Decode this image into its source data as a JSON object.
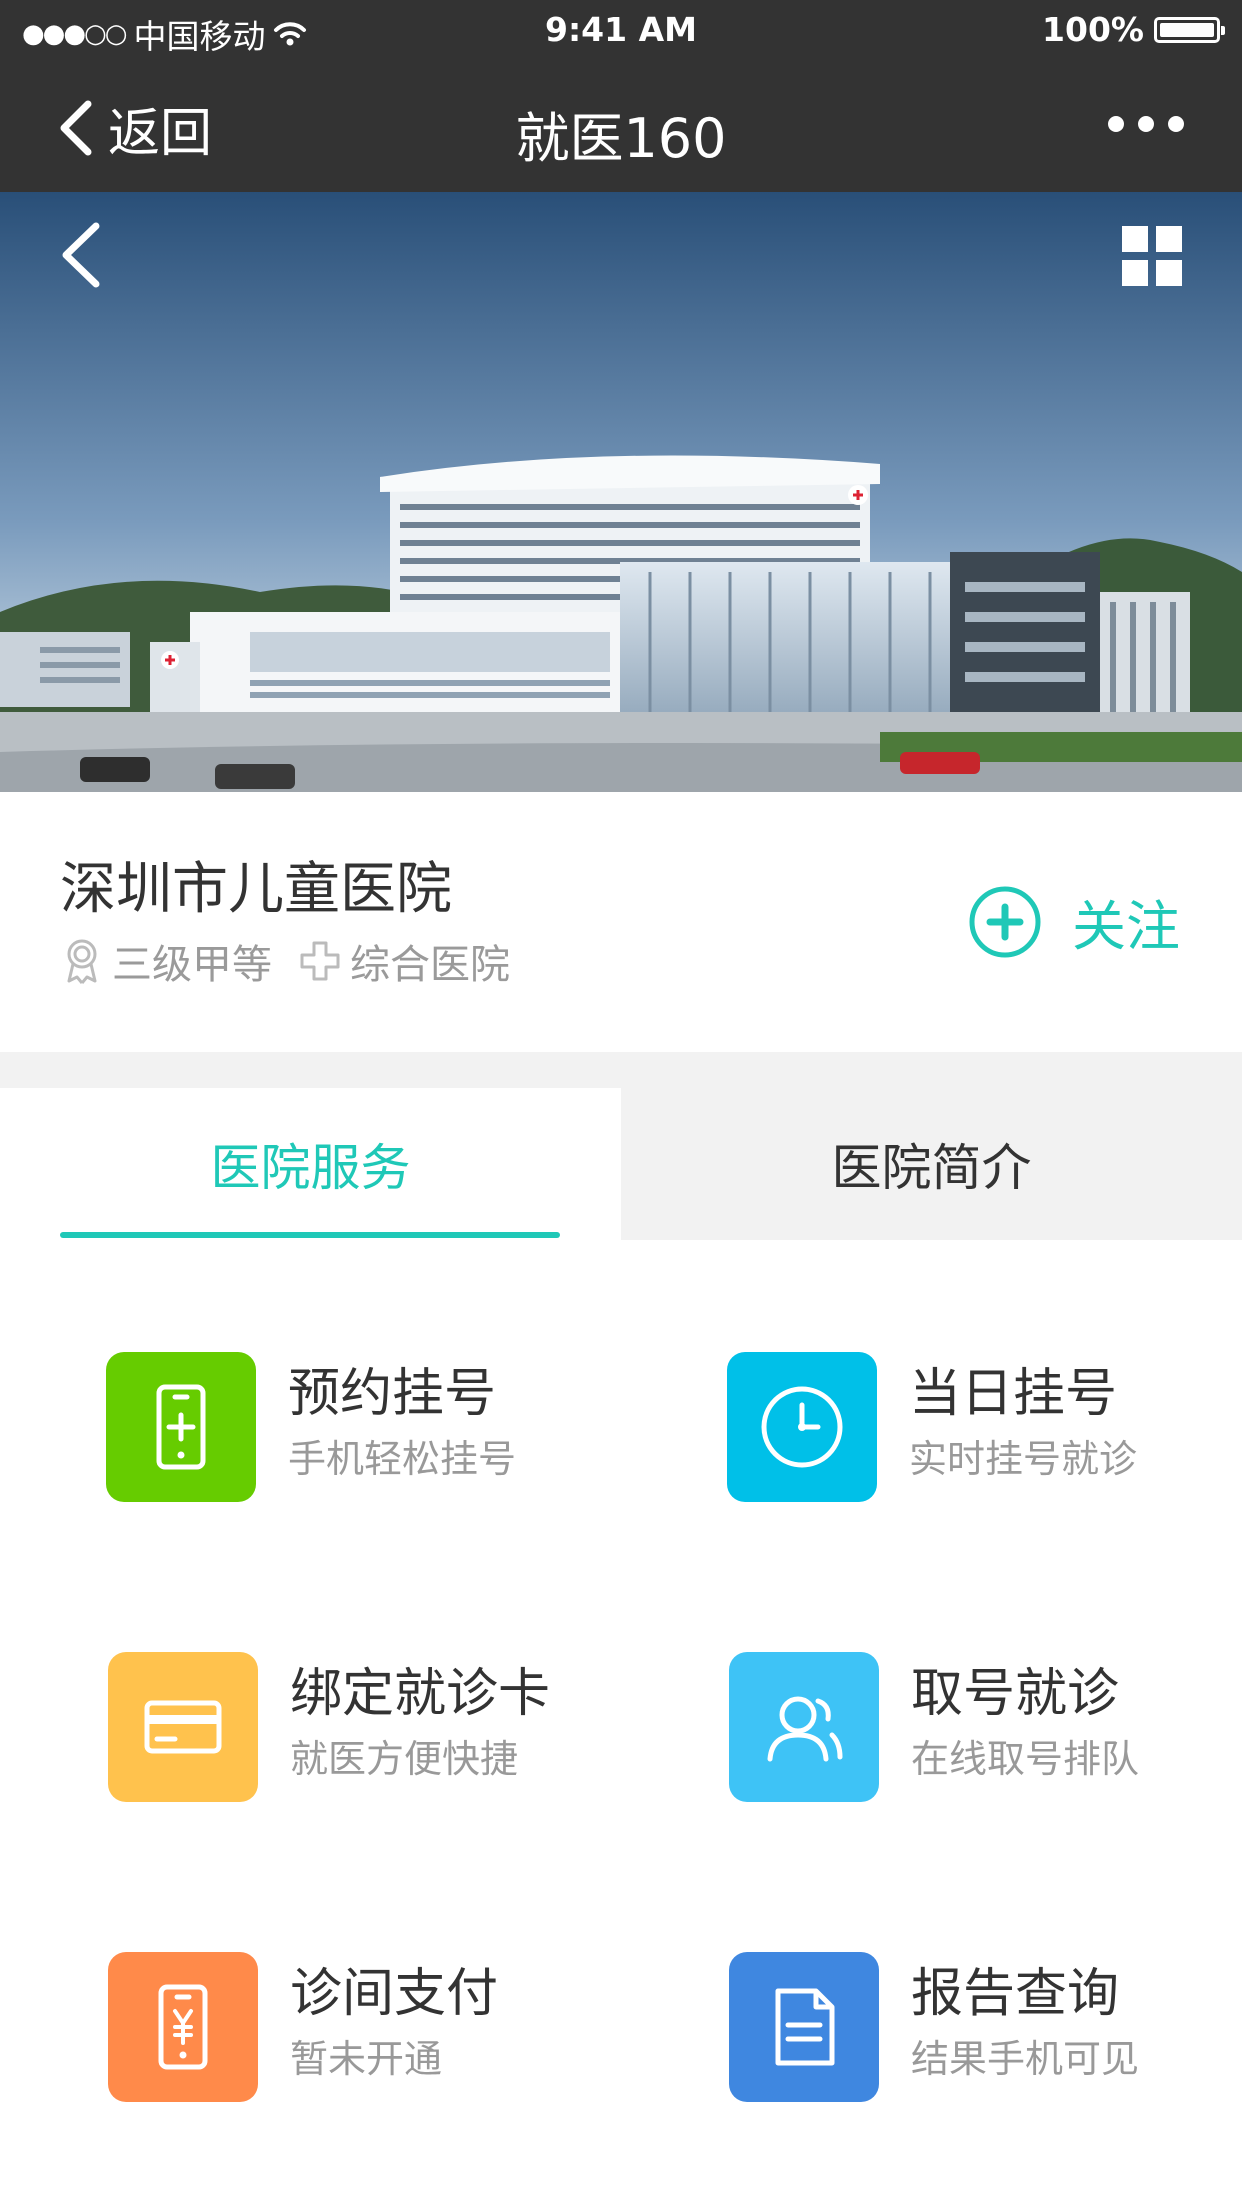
{
  "status_bar": {
    "signal": "●●●○○",
    "carrier": "中国移动",
    "time": "9:41 AM",
    "battery": "100%"
  },
  "nav": {
    "back_label": "返回",
    "title": "就医160"
  },
  "hospital": {
    "name": "深圳市儿童医院",
    "level": "三级甲等",
    "type": "综合医院",
    "follow_label": "关注"
  },
  "tabs": [
    {
      "label": "医院服务",
      "active": true
    },
    {
      "label": "医院简介",
      "active": false
    }
  ],
  "services": [
    {
      "title": "预约挂号",
      "subtitle": "手机轻松挂号",
      "icon": "phone-plus-icon",
      "color": "#66cc00"
    },
    {
      "title": "当日挂号",
      "subtitle": "实时挂号就诊",
      "icon": "clock-icon",
      "color": "#00c0e8"
    },
    {
      "title": "绑定就诊卡",
      "subtitle": "就医方便快捷",
      "icon": "card-icon",
      "color": "#ffc24d"
    },
    {
      "title": "取号就诊",
      "subtitle": "在线取号排队",
      "icon": "users-icon",
      "color": "#3ec3f6"
    },
    {
      "title": "诊间支付",
      "subtitle": "暂未开通",
      "icon": "phone-yuan-icon",
      "color": "#ff8a4a"
    },
    {
      "title": "报告查询",
      "subtitle": "结果手机可见",
      "icon": "document-icon",
      "color": "#3f87e0"
    }
  ],
  "colors": {
    "accent": "#1fc8b7",
    "header_bg": "#333333"
  }
}
